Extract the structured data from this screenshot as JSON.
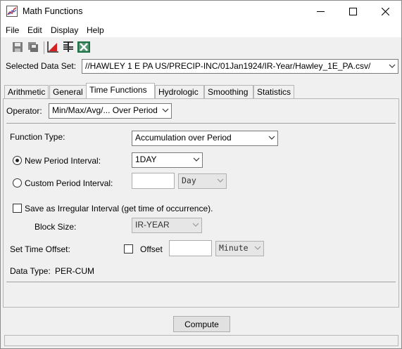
{
  "window": {
    "title": "Math Functions",
    "controls": {
      "minimize": "minimize-icon",
      "maximize": "maximize-icon",
      "close": "close-icon"
    }
  },
  "menu": [
    "File",
    "Edit",
    "Display",
    "Help"
  ],
  "toolbar": {
    "icons": [
      "save-icon",
      "save-as-icon",
      "plot-icon",
      "tabulate-icon",
      "excel-icon"
    ]
  },
  "selected_data_set": {
    "label": "Selected Data Set:",
    "value": "//HAWLEY 1 E PA US/PRECIP-INC/01Jan1924/IR-Year/Hawley_1E_PA.csv/"
  },
  "tabs": [
    "Arithmetic",
    "General",
    "Time Functions",
    "Hydrologic",
    "Smoothing",
    "Statistics"
  ],
  "active_tab": "Time Functions",
  "operator": {
    "label": "Operator:",
    "value": "Min/Max/Avg/... Over Period"
  },
  "function_type": {
    "label": "Function Type:",
    "value": "Accumulation over Period"
  },
  "new_period": {
    "label": "New Period Interval:",
    "value": "1DAY",
    "selected": true
  },
  "custom_period": {
    "label": "Custom Period Interval:",
    "value": "",
    "unit": "Day",
    "selected": false
  },
  "irregular": {
    "label": "Save as Irregular Interval (get time of occurrence).",
    "checked": false
  },
  "block_size": {
    "label": "Block Size:",
    "value": "IR-YEAR"
  },
  "time_offset": {
    "label": "Set Time Offset:",
    "offset_label": "Offset",
    "value": "",
    "unit": "Minute",
    "checked": false
  },
  "data_type": {
    "label": "Data Type:",
    "value": "PER-CUM"
  },
  "compute_button": "Compute",
  "colors": {
    "accent": "#0078d7",
    "excel_green": "#1e7145",
    "plot_red": "#d42020"
  }
}
